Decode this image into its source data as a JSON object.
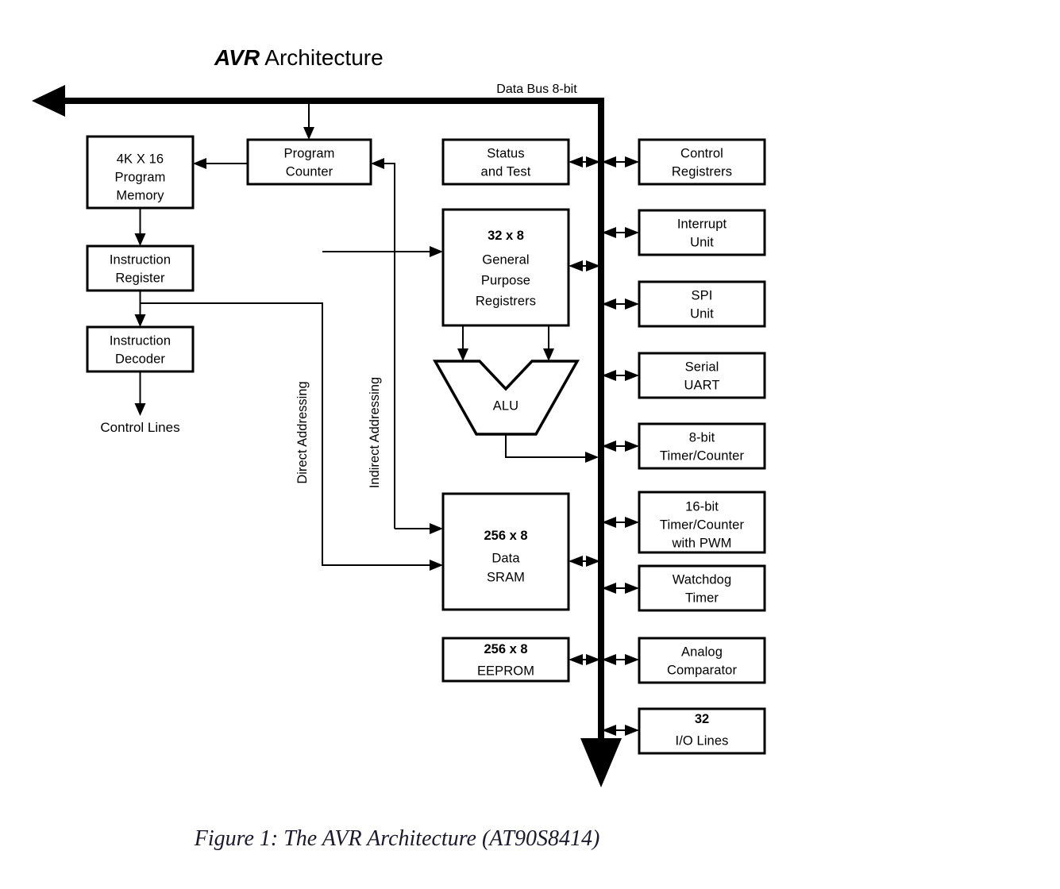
{
  "title": {
    "emphasis": "AVR",
    "rest": " Architecture"
  },
  "caption": "Figure 1: The AVR Architecture (AT90S8414)",
  "bus": {
    "label": "Data Bus 8-bit",
    "color": "#000000"
  },
  "labels": {
    "control_lines": "Control Lines",
    "direct_addressing": "Direct Addressing",
    "indirect_addressing": "Indirect Addressing"
  },
  "blocks": {
    "program_memory": {
      "lines": [
        "4K X 16",
        "Program",
        "Memory"
      ]
    },
    "program_counter": {
      "lines": [
        "Program",
        "Counter"
      ]
    },
    "instruction_register": {
      "lines": [
        "Instruction",
        "Register"
      ]
    },
    "instruction_decoder": {
      "lines": [
        "Instruction",
        "Decoder"
      ]
    },
    "status_and_test": {
      "lines": [
        "Status",
        "and Test"
      ]
    },
    "general_purpose_registers": {
      "lines": [
        "32 x 8",
        "General",
        "Purpose",
        "Registrers"
      ]
    },
    "alu": {
      "lines": [
        "ALU"
      ]
    },
    "data_sram": {
      "lines": [
        "256 x 8",
        "Data",
        "SRAM"
      ]
    },
    "eeprom": {
      "lines": [
        "256 x 8",
        "EEPROM"
      ]
    },
    "control_registers": {
      "lines": [
        "Control",
        "Registrers"
      ]
    },
    "interrupt_unit": {
      "lines": [
        "Interrupt",
        "Unit"
      ]
    },
    "spi_unit": {
      "lines": [
        "SPI",
        "Unit"
      ]
    },
    "serial_uart": {
      "lines": [
        "Serial",
        "UART"
      ]
    },
    "timer_8bit": {
      "lines": [
        "8-bit",
        "Timer/Counter"
      ]
    },
    "timer_16bit": {
      "lines": [
        "16-bit",
        "Timer/Counter",
        "with PWM"
      ]
    },
    "watchdog_timer": {
      "lines": [
        "Watchdog",
        "Timer"
      ]
    },
    "analog_comparator": {
      "lines": [
        "Analog",
        "Comparator"
      ]
    },
    "io_lines": {
      "lines": [
        "32",
        "I/O Lines"
      ]
    }
  },
  "chart_data": {
    "type": "diagram",
    "title": "AVR Architecture",
    "nodes": [
      "4K X 16 Program Memory",
      "Program Counter",
      "Instruction Register",
      "Instruction Decoder",
      "Control Lines",
      "Status and Test",
      "32 x 8 General Purpose Registrers",
      "ALU",
      "256 x 8 Data SRAM",
      "256 x 8 EEPROM",
      "Control Registrers",
      "Interrupt Unit",
      "SPI Unit",
      "Serial UART",
      "8-bit Timer/Counter",
      "16-bit Timer/Counter with PWM",
      "Watchdog Timer",
      "Analog Comparator",
      "32 I/O Lines"
    ],
    "edges": [
      {
        "from": "Data Bus 8-bit",
        "to": "Program Counter",
        "type": "arrow"
      },
      {
        "from": "Program Counter",
        "to": "4K X 16 Program Memory",
        "type": "arrow"
      },
      {
        "from": "4K X 16 Program Memory",
        "to": "Instruction Register",
        "type": "arrow"
      },
      {
        "from": "Instruction Register",
        "to": "Instruction Decoder",
        "type": "arrow"
      },
      {
        "from": "Instruction Decoder",
        "to": "Control Lines",
        "type": "arrow"
      },
      {
        "from": "Instruction Register",
        "to": "Direct Addressing",
        "type": "line"
      },
      {
        "from": "Direct Addressing",
        "to": "32 x 8 General Purpose Registrers",
        "type": "arrow"
      },
      {
        "from": "Direct Addressing",
        "to": "256 x 8 Data SRAM",
        "type": "arrow"
      },
      {
        "from": "Indirect Addressing",
        "to": "Program Counter",
        "type": "arrow"
      },
      {
        "from": "Indirect Addressing",
        "to": "256 x 8 Data SRAM",
        "type": "arrow"
      },
      {
        "from": "32 x 8 General Purpose Registrers",
        "to": "ALU",
        "type": "arrow"
      },
      {
        "from": "ALU",
        "to": "Data Bus 8-bit",
        "type": "arrow"
      },
      {
        "from": "Status and Test",
        "to": "Data Bus 8-bit",
        "type": "bidirectional"
      },
      {
        "from": "32 x 8 General Purpose Registrers",
        "to": "Data Bus 8-bit",
        "type": "bidirectional"
      },
      {
        "from": "256 x 8 Data SRAM",
        "to": "Data Bus 8-bit",
        "type": "bidirectional"
      },
      {
        "from": "256 x 8 EEPROM",
        "to": "Data Bus 8-bit",
        "type": "bidirectional"
      },
      {
        "from": "Data Bus 8-bit",
        "to": "Control Registrers",
        "type": "bidirectional"
      },
      {
        "from": "Data Bus 8-bit",
        "to": "Interrupt Unit",
        "type": "bidirectional"
      },
      {
        "from": "Data Bus 8-bit",
        "to": "SPI Unit",
        "type": "bidirectional"
      },
      {
        "from": "Data Bus 8-bit",
        "to": "Serial UART",
        "type": "bidirectional"
      },
      {
        "from": "Data Bus 8-bit",
        "to": "8-bit Timer/Counter",
        "type": "bidirectional"
      },
      {
        "from": "Data Bus 8-bit",
        "to": "16-bit Timer/Counter with PWM",
        "type": "bidirectional"
      },
      {
        "from": "Data Bus 8-bit",
        "to": "Watchdog Timer",
        "type": "bidirectional"
      },
      {
        "from": "Data Bus 8-bit",
        "to": "Analog Comparator",
        "type": "bidirectional"
      },
      {
        "from": "Data Bus 8-bit",
        "to": "32 I/O Lines",
        "type": "bidirectional"
      }
    ]
  }
}
